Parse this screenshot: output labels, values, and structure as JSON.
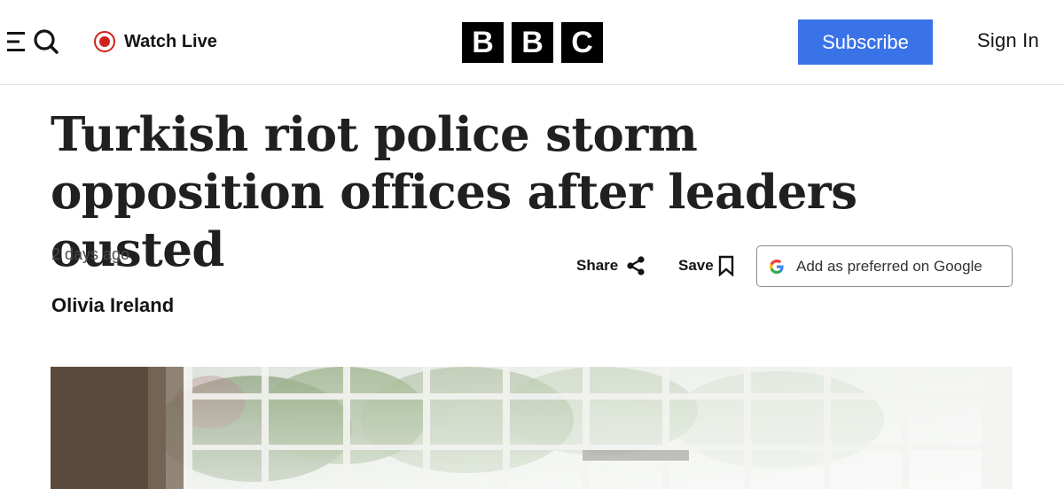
{
  "header": {
    "watch_live_label": "Watch Live",
    "logo_letters": [
      "B",
      "B",
      "C"
    ],
    "subscribe_label": "Subscribe",
    "sign_in_label": "Sign In",
    "accent_color": "#3a73e8",
    "live_color": "#d0211c"
  },
  "article": {
    "headline": "Turkish riot police storm opposition offices after leaders ousted",
    "timestamp": "2 days ago",
    "author": "Olivia Ireland"
  },
  "actions": {
    "share_label": "Share",
    "save_label": "Save",
    "google_label": "Add as preferred on Google"
  },
  "icons": [
    "menu-search-icon",
    "live-icon",
    "share-icon",
    "bookmark-icon",
    "google-icon"
  ]
}
